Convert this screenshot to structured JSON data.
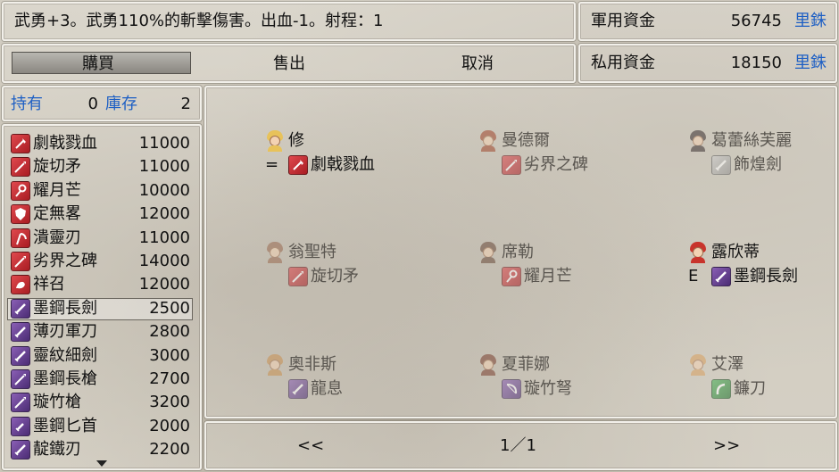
{
  "help": {
    "text": "武勇+3。武勇110%的斬擊傷害。出血-1。射程：1"
  },
  "funds": {
    "army_label": "軍用資金",
    "army_value": "56745",
    "army_unit": "里銖",
    "private_label": "私用資金",
    "private_value": "18150",
    "private_unit": "里銖"
  },
  "commands": {
    "buy": "購買",
    "sell": "售出",
    "cancel": "取消"
  },
  "stock": {
    "own_label": "持有",
    "own_value": "0",
    "store_label": "庫存",
    "store_value": "2"
  },
  "shop_items": [
    {
      "name": "劇戟戮血",
      "price": "11000",
      "color": "red",
      "icon": "axe-icon"
    },
    {
      "name": "旋切矛",
      "price": "11000",
      "color": "red",
      "icon": "spear-icon"
    },
    {
      "name": "耀月芒",
      "price": "10000",
      "color": "red",
      "icon": "staff-icon"
    },
    {
      "name": "定無畧",
      "price": "12000",
      "color": "red",
      "icon": "shield-icon"
    },
    {
      "name": "潰靈刃",
      "price": "11000",
      "color": "red",
      "icon": "scythe-icon"
    },
    {
      "name": "劣界之碑",
      "price": "14000",
      "color": "red",
      "icon": "spear-icon"
    },
    {
      "name": "祥召",
      "price": "12000",
      "color": "red",
      "icon": "dragon-icon"
    },
    {
      "name": "墨鋼長劍",
      "price": "2500",
      "color": "purple",
      "icon": "sword-icon"
    },
    {
      "name": "薄刃軍刀",
      "price": "2800",
      "color": "purple",
      "icon": "sword-icon"
    },
    {
      "name": "靈紋細劍",
      "price": "3000",
      "color": "purple",
      "icon": "sword-icon"
    },
    {
      "name": "墨鋼長槍",
      "price": "2700",
      "color": "purple",
      "icon": "spear-icon"
    },
    {
      "name": "璇竹槍",
      "price": "3200",
      "color": "purple",
      "icon": "spear-icon"
    },
    {
      "name": "墨鋼匕首",
      "price": "2000",
      "color": "purple",
      "icon": "dagger-icon"
    },
    {
      "name": "靛鐵刃",
      "price": "2200",
      "color": "purple",
      "icon": "sword-icon"
    }
  ],
  "characters": [
    {
      "name": "修",
      "marker": "=",
      "weapon": "劇戟戮血",
      "wcolor": "red",
      "hair": "#e8c25a",
      "active": true
    },
    {
      "name": "曼德爾",
      "marker": "",
      "weapon": "劣界之碑",
      "wcolor": "red",
      "hair": "#a0462c",
      "active": false
    },
    {
      "name": "葛蕾絲芙麗",
      "marker": "",
      "weapon": "飾煌劍",
      "wcolor": "gray",
      "hair": "#3a3030",
      "active": false
    },
    {
      "name": "翁聖特",
      "marker": "",
      "weapon": "旋切矛",
      "wcolor": "red",
      "hair": "#9a6a50",
      "active": false
    },
    {
      "name": "席勒",
      "marker": "",
      "weapon": "耀月芒",
      "wcolor": "red",
      "hair": "#6a4a3a",
      "active": false
    },
    {
      "name": "露欣蒂",
      "marker": "E",
      "weapon": "墨鋼長劍",
      "wcolor": "purple",
      "hair": "#c8342c",
      "active": true
    },
    {
      "name": "奧非斯",
      "marker": "",
      "weapon": "龍息",
      "wcolor": "purple",
      "hair": "#c89050",
      "active": false
    },
    {
      "name": "夏菲娜",
      "marker": "",
      "weapon": "璇竹弩",
      "wcolor": "purple",
      "hair": "#7a4030",
      "active": false
    },
    {
      "name": "艾澤",
      "marker": "",
      "weapon": "鐮刀",
      "wcolor": "green",
      "hair": "#d8a060",
      "active": false
    }
  ],
  "pager": {
    "prev": "<<",
    "page": "1／1",
    "next": ">>"
  }
}
